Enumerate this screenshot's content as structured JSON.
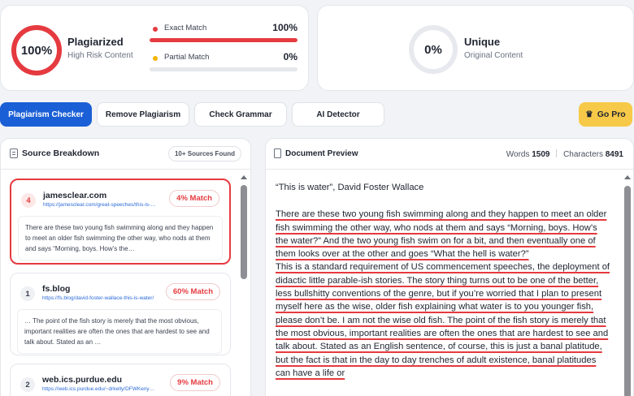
{
  "summary": {
    "plagiarized": {
      "percent": "100%",
      "title": "Plagiarized",
      "subtitle": "High Risk Content"
    },
    "unique": {
      "percent": "0%",
      "title": "Unique",
      "subtitle": "Original Content"
    },
    "exact_match": {
      "label": "Exact Match",
      "value": "100%",
      "fraction": 1.0,
      "color": "#e53a3f"
    },
    "partial_match": {
      "label": "Partial Match",
      "value": "0%",
      "fraction": 0.0,
      "color": "#f5b400"
    }
  },
  "tabs": {
    "plagiarism_checker": "Plagiarism Checker",
    "remove_plagiarism": "Remove Plagiarism",
    "check_grammar": "Check Grammar",
    "ai_detector": "AI Detector",
    "go_pro": "Go Pro",
    "go_pro_icon": "crown-icon"
  },
  "sources": {
    "title": "Source Breakdown",
    "badge": "10+ Sources Found",
    "items": [
      {
        "num": "4",
        "domain": "jamesclear.com",
        "url": "https://jamesclear.com/great-speeches/this-is-water-by-david-foster-wallace",
        "match": "4% Match",
        "snippet": "There are these two young fish swimming along and they happen to meet an older fish swimming the other way, who nods at them and says “Morning, boys. How’s the…"
      },
      {
        "num": "1",
        "domain": "fs.blog",
        "url": "https://fs.blog/david-foster-wallace-this-is-water/",
        "match": "60% Match",
        "snippet": "… The point of the fish story is merely that the most obvious, important realities are often the ones that are hardest to see and talk about. Stated as an …"
      },
      {
        "num": "2",
        "domain": "web.ics.purdue.edu",
        "url": "https://web.ics.purdue.edu/~drkelly/DFWKenyonAddress2005.pdf",
        "match": "9% Match",
        "snippet": ""
      }
    ]
  },
  "document": {
    "title": "Document Preview",
    "words_label": "Words",
    "words_value": "1509",
    "chars_label": "Characters",
    "chars_value": "8491",
    "heading": "“This is water”, David Foster Wallace",
    "p1": "There are these two young fish swimming along and they happen to meet an older fish swimming the other way, who nods at them and says “Morning, boys. How’s the water?” And the two young fish swim on for a bit, and then eventually one of them looks over at the other and goes “What the hell is water?”",
    "p2": "This is a standard requirement of US commencement speeches, the deployment of didactic little parable-ish stories. The story thing turns out to be one of the better, less bullshitty conventions of the genre, but if you’re worried that I plan to present myself here as the wise, older fish explaining what water is to you younger fish, please don’t be. I am not the wise old fish. The point of the fish story is merely that the most obvious, important realities are often the ones that are hardest to see and talk about. Stated as an English sentence, of course, this is just a banal platitude, but the fact is that in the day to day trenches of adult existence, banal platitudes can have a life or"
  }
}
